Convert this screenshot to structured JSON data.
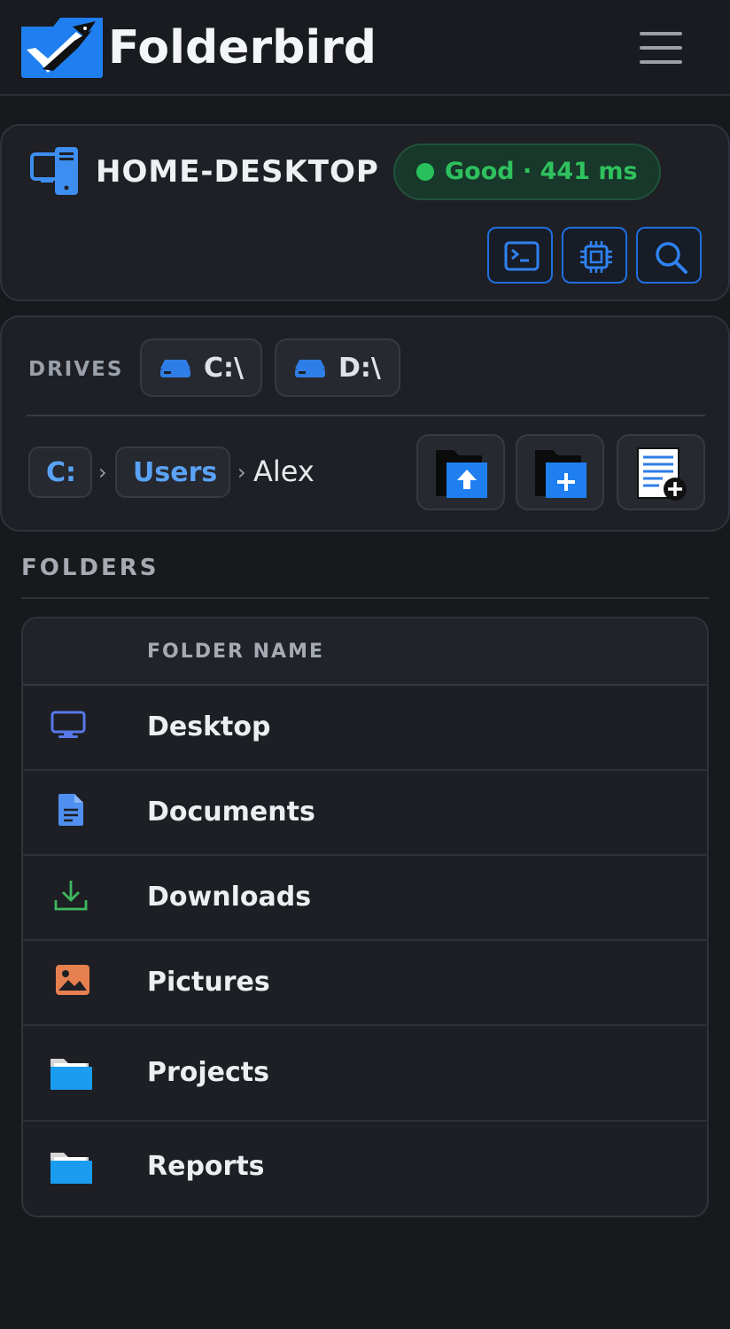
{
  "app": {
    "name": "Folderbird"
  },
  "device": {
    "name": "HOME-DESKTOP",
    "status": "Good · 441 ms",
    "status_color": "#2fc15e"
  },
  "toolbar": {
    "icons": [
      "terminal-icon",
      "cpu-icon",
      "search-icon"
    ]
  },
  "drives": {
    "label": "DRIVES",
    "items": [
      {
        "label": "C:\\",
        "icon": "drive-icon"
      },
      {
        "label": "D:\\",
        "icon": "drive-icon"
      }
    ]
  },
  "breadcrumb": {
    "items": [
      "C:",
      "Users"
    ],
    "separator": "›",
    "current": "Alex"
  },
  "actions": [
    "upload-folder-icon",
    "new-folder-icon",
    "new-file-icon"
  ],
  "folders": {
    "title": "FOLDERS",
    "column_header": "FOLDER NAME",
    "rows": [
      {
        "name": "Desktop",
        "icon": "monitor-icon"
      },
      {
        "name": "Documents",
        "icon": "document-icon"
      },
      {
        "name": "Downloads",
        "icon": "download-icon"
      },
      {
        "name": "Pictures",
        "icon": "picture-icon"
      },
      {
        "name": "Projects",
        "icon": "folder-icon"
      },
      {
        "name": "Reports",
        "icon": "folder-icon"
      }
    ]
  },
  "colors": {
    "accent": "#1f6fe0",
    "background": "#17191d",
    "card": "#1e2026",
    "link": "#5aa2f5"
  }
}
